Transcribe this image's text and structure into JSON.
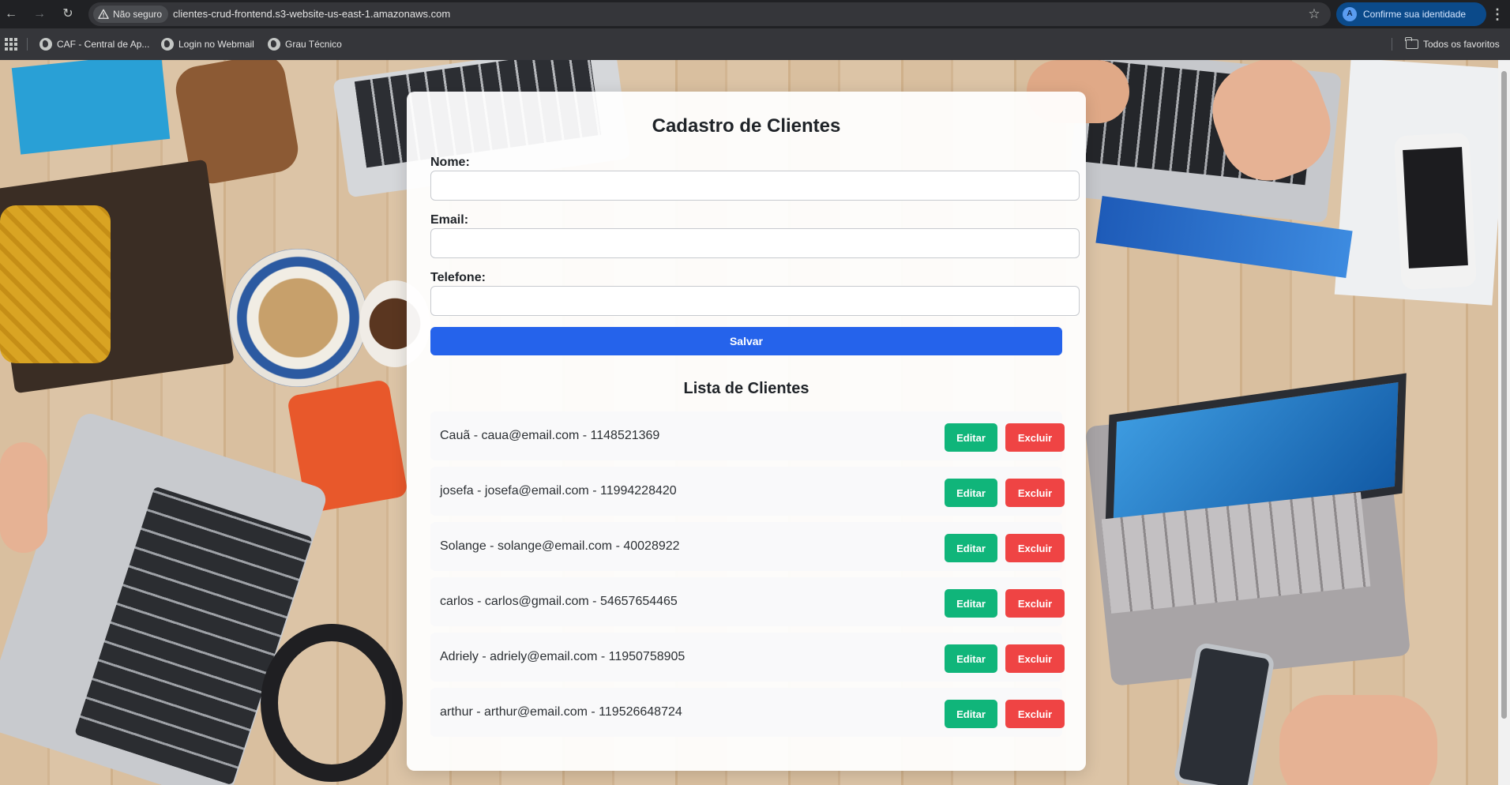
{
  "browser": {
    "security_label": "Não seguro",
    "url": "clientes-crud-frontend.s3-website-us-east-1.amazonaws.com",
    "profile_initial": "A",
    "profile_label": "Confirme sua identidade"
  },
  "bookmarks": {
    "items": [
      {
        "label": "CAF - Central de Ap..."
      },
      {
        "label": "Login no Webmail"
      },
      {
        "label": "Grau Técnico"
      }
    ],
    "all_favorites_label": "Todos os favoritos"
  },
  "form": {
    "title": "Cadastro de Clientes",
    "name_label": "Nome:",
    "name_value": "",
    "email_label": "Email:",
    "email_value": "",
    "phone_label": "Telefone:",
    "phone_value": "",
    "save_label": "Salvar"
  },
  "list": {
    "title": "Lista de Clientes",
    "edit_label": "Editar",
    "delete_label": "Excluir",
    "clients": [
      {
        "text": "Cauã - caua@email.com - 1148521369"
      },
      {
        "text": "josefa - josefa@email.com - 11994228420"
      },
      {
        "text": "Solange - solange@email.com - 40028922"
      },
      {
        "text": "carlos - carlos@gmail.com - 54657654465"
      },
      {
        "text": "Adriely - adriely@email.com - 11950758905"
      },
      {
        "text": "arthur - arthur@email.com - 119526648724"
      }
    ]
  },
  "colors": {
    "primary": "#2563eb",
    "edit": "#10b57a",
    "delete": "#ef4444"
  }
}
